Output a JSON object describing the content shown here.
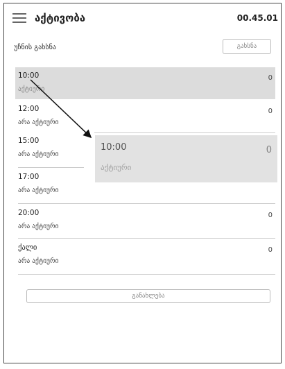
{
  "header": {
    "menu_icon": "hamburger-menu-icon",
    "title": "აქტივობა",
    "time": "00.45.01"
  },
  "section": {
    "label": "უჩნის გახსნა",
    "button_label": "გახსნა"
  },
  "slots": [
    {
      "time": "10:00",
      "status": "აქტიური",
      "count": "0",
      "active": true
    },
    {
      "time": "12:00",
      "status": "არა აქტიური",
      "count": "0"
    },
    {
      "time": "15:00",
      "status": "არა აქტიური",
      "count": ""
    },
    {
      "time": "17:00",
      "status": "არა აქტიური",
      "count": ""
    },
    {
      "time": "20:00",
      "status": "არა აქტიური",
      "count": "0"
    },
    {
      "time": "ქალი",
      "status": "არა აქტიური",
      "count": "0"
    }
  ],
  "drag_preview": {
    "time": "10:00",
    "status": "აქტიური",
    "count": "0"
  },
  "footer": {
    "button_label": "განახლება"
  }
}
